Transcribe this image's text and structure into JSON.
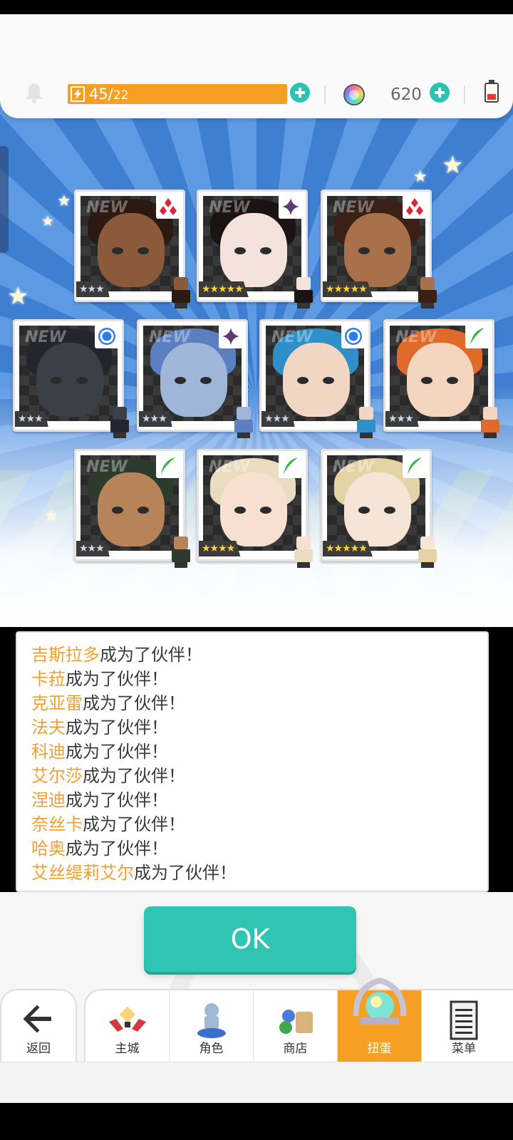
{
  "header": {
    "stamina_current": "45",
    "stamina_separator": "/",
    "stamina_max": "22",
    "gems": "620"
  },
  "cards": [
    {
      "name": "吉斯拉多",
      "element": "diamond",
      "rarity": 3,
      "rarity_text": "★★★",
      "new": "NEW"
    },
    {
      "name": "卡菈",
      "element": "sparkle",
      "rarity": 5,
      "rarity_text": "★★★★★",
      "new": "NEW"
    },
    {
      "name": "克亚雷",
      "element": "diamond",
      "rarity": 5,
      "rarity_text": "★★★★★",
      "new": "NEW"
    },
    {
      "name": "法夫",
      "element": "circle",
      "rarity": 3,
      "rarity_text": "★★★",
      "new": "NEW"
    },
    {
      "name": "科迪",
      "element": "sparkle",
      "rarity": 3,
      "rarity_text": "★★★",
      "new": "NEW"
    },
    {
      "name": "艾尔莎",
      "element": "circle",
      "rarity": 3,
      "rarity_text": "★★★",
      "new": "NEW"
    },
    {
      "name": "涅迪",
      "element": "leaf",
      "rarity": 3,
      "rarity_text": "★★★",
      "new": "NEW"
    },
    {
      "name": "奈丝卡",
      "element": "leaf",
      "rarity": 3,
      "rarity_text": "★★★",
      "new": "NEW"
    },
    {
      "name": "哈奥",
      "element": "leaf",
      "rarity": 4,
      "rarity_text": "★★★★",
      "new": "NEW"
    },
    {
      "name": "艾丝缇莉艾尔",
      "element": "leaf",
      "rarity": 5,
      "rarity_text": "★★★★★",
      "new": "NEW"
    }
  ],
  "log": {
    "suffix": "成为了伙伴！",
    "entries": [
      "吉斯拉多",
      "卡菈",
      "克亚雷",
      "法夫",
      "科迪",
      "艾尔莎",
      "涅迪",
      "奈丝卡",
      "哈奥",
      "艾丝缇莉艾尔"
    ]
  },
  "ok_label": "OK",
  "nav": {
    "back": "返回",
    "tabs": [
      "主城",
      "角色",
      "商店",
      "扭蛋",
      "菜单"
    ],
    "active": "扭蛋"
  },
  "colors": {
    "accent_teal": "#2fc5b2",
    "accent_orange": "#f5a023",
    "name_orange": "#f0a030"
  }
}
